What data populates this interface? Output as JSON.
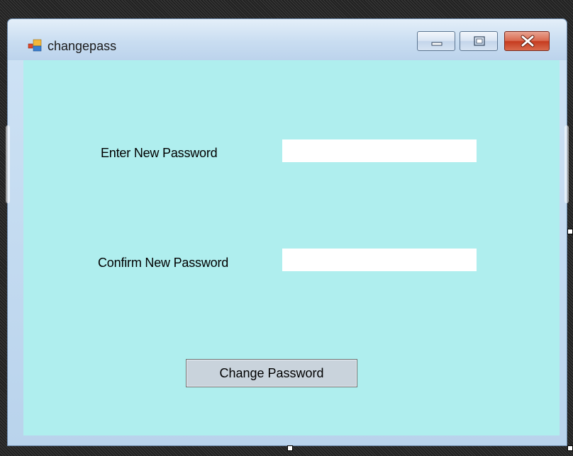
{
  "window": {
    "title": "changepass",
    "icon": "form-app-icon",
    "client_background": "#afeeee"
  },
  "caption_buttons": {
    "minimize_icon": "minimize-icon",
    "maximize_icon": "maximize-icon",
    "close_icon": "close-icon"
  },
  "form": {
    "new_password_label": "Enter New Password",
    "new_password_value": "",
    "confirm_password_label": "Confirm New Password",
    "confirm_password_value": "",
    "submit_label": "Change Password"
  }
}
